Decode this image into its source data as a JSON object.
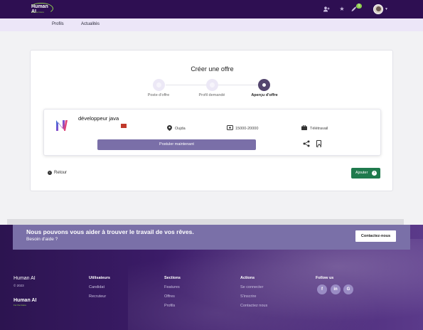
{
  "header": {
    "logo_text": "Human AI",
    "logo_sub": "For the future",
    "notification_count": "1",
    "icons": [
      "add-user-icon",
      "star-icon",
      "rocket-icon",
      "avatar",
      "chevron-down-icon"
    ]
  },
  "subnav": {
    "items": [
      "Profils",
      "Actualités"
    ]
  },
  "card": {
    "title": "Créer une offre",
    "steps": [
      {
        "label": "Poste d'offre",
        "state": "done"
      },
      {
        "label": "Profil demandé",
        "state": "done"
      },
      {
        "label": "Aperçu d'offre",
        "state": "active"
      }
    ],
    "job": {
      "title": "développeur java",
      "location": "Oujda",
      "salary": "15000-20000",
      "mode": "Télétravail",
      "apply_label": "Postuler maintenant"
    },
    "back_label": "Retour",
    "add_label": "Ajouter"
  },
  "footer": {
    "cta_title": "Nous pouvons vous aider à trouver le travail de vos rêves.",
    "cta_sub": "Besoin d'aide ?",
    "cta_button": "Contactez-nous",
    "brand": "Human AI",
    "copyright": "© 2023",
    "logo_text": "Human AI",
    "logo_sub": "For the future",
    "columns": [
      {
        "title": "Utilisateurs",
        "links": [
          "Candidat",
          "Recruteur"
        ]
      },
      {
        "title": "Sections",
        "links": [
          "Features",
          "Offres",
          "Profils"
        ]
      },
      {
        "title": "Actions",
        "links": [
          "Se connecter",
          "S'inscrire",
          "Contactez nous"
        ]
      }
    ],
    "follow_title": "Follow us",
    "social": [
      "facebook-icon",
      "linkedin-icon",
      "google-icon"
    ]
  },
  "colors": {
    "header_bg": "#2e0f52",
    "subnav_bg": "#ece6f8",
    "accent_purple": "#7a6fa8",
    "add_green": "#1f7a4d",
    "logo_green": "#8fd14f"
  }
}
